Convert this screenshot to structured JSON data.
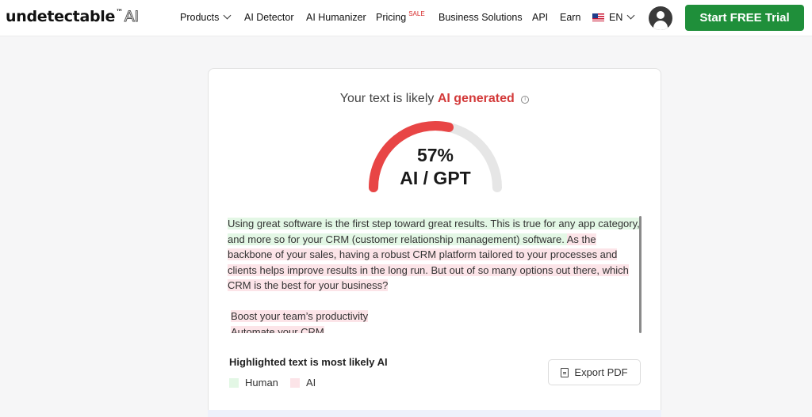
{
  "header": {
    "logo_text": "undetectable",
    "logo_tm": "™",
    "logo_suffix": "AI",
    "nav": {
      "products": "Products",
      "ai_detector": "AI Detector",
      "ai_humanizer": "AI Humanizer",
      "pricing": "Pricing",
      "pricing_badge": "SALE",
      "business": "Business Solutions",
      "api": "API",
      "earn": "Earn",
      "language": "EN"
    },
    "cta_label": "Start FREE Trial"
  },
  "result": {
    "title_prefix": "Your text is likely",
    "title_highlight": "AI generated",
    "info_glyph": "i",
    "gauge_value": 57,
    "gauge_percent_text": "57%",
    "gauge_label": "AI / GPT",
    "colors": {
      "gauge_fill": "#e84545",
      "gauge_track": "#e6e6e6",
      "human_highlight": "#e3f7e5",
      "ai_highlight": "#fce4e8",
      "cta": "#1f8f3a"
    }
  },
  "analyzed_text": {
    "segments": [
      {
        "type": "human",
        "text": "Using great software is the first step toward great results.  This is true for any app category, and more so for your CRM (customer relationship management) software. "
      },
      {
        "type": "ai",
        "text": " As the backbone of your sales, having a robust CRM platform tailored to your processes and clients helps improve results in the long run.  But out of so many options out there, which CRM is the best for your business?"
      }
    ],
    "list_items": [
      "Boost your team’s productivity",
      "Automate your CRM"
    ]
  },
  "legend": {
    "title": "Highlighted text is most likely AI",
    "human_label": "Human",
    "ai_label": "AI"
  },
  "export_label": "Export PDF"
}
